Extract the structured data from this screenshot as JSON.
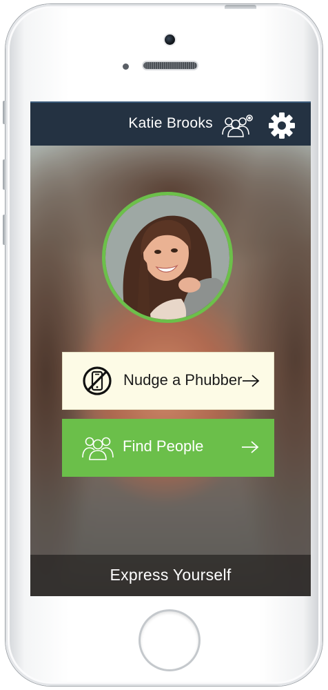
{
  "header": {
    "user_name": "Katie Brooks",
    "people_icon": "group-settings-icon",
    "settings_icon": "gear-icon",
    "bg_color": "#243242"
  },
  "profile": {
    "avatar_icon": "profile-photo",
    "ring_color": "#6cc04a"
  },
  "actions": {
    "nudge": {
      "label": "Nudge a Phubber",
      "icon": "no-phone-icon",
      "arrow_icon": "arrow-right-icon",
      "bg_color": "#fdfbe6"
    },
    "find": {
      "label": "Find People",
      "icon": "people-icon",
      "arrow_icon": "arrow-right-icon",
      "bg_color": "#6bbf4a"
    }
  },
  "footer": {
    "label": "Express Yourself"
  }
}
